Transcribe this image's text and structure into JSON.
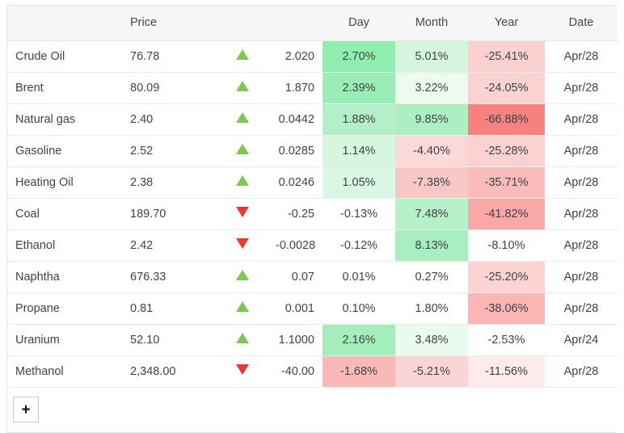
{
  "table": {
    "columns": [
      {
        "key": "name",
        "label": "",
        "align": "left"
      },
      {
        "key": "price",
        "label": "Price",
        "align": "left"
      },
      {
        "key": "arrow",
        "label": "",
        "align": "center"
      },
      {
        "key": "change",
        "label": "",
        "align": "right"
      },
      {
        "key": "day",
        "label": "Day",
        "align": "center"
      },
      {
        "key": "month",
        "label": "Month",
        "align": "center"
      },
      {
        "key": "year",
        "label": "Year",
        "align": "center"
      },
      {
        "key": "date",
        "label": "Date",
        "align": "center"
      }
    ],
    "rows": [
      {
        "name": "Crude Oil",
        "price": "76.78",
        "direction": "up",
        "change": "2.020",
        "day": "2.70%",
        "day_bg": "#90eeaf",
        "month": "5.01%",
        "month_bg": "#d5f5de",
        "year": "-25.41%",
        "year_bg": "#fbd0d0",
        "date": "Apr/28"
      },
      {
        "name": "Brent",
        "price": "80.09",
        "direction": "up",
        "change": "1.870",
        "day": "2.39%",
        "day_bg": "#9aeeb5",
        "month": "3.22%",
        "month_bg": "#ecfaf0",
        "year": "-24.05%",
        "year_bg": "#fbd3d3",
        "date": "Apr/28"
      },
      {
        "name": "Natural gas",
        "price": "2.40",
        "direction": "up",
        "change": "0.0442",
        "day": "1.88%",
        "day_bg": "#b3f0c7",
        "month": "9.85%",
        "month_bg": "#acefc2",
        "year": "-66.88%",
        "year_bg": "#f6817f",
        "date": "Apr/28"
      },
      {
        "name": "Gasoline",
        "price": "2.52",
        "direction": "up",
        "change": "0.0285",
        "day": "1.14%",
        "day_bg": "#d6f6e0",
        "month": "-4.40%",
        "month_bg": "#fbd9d9",
        "year": "-25.28%",
        "year_bg": "#fbd1d1",
        "date": "Apr/28"
      },
      {
        "name": "Heating Oil",
        "price": "2.38",
        "direction": "up",
        "change": "0.0246",
        "day": "1.05%",
        "day_bg": "#d9f7e2",
        "month": "-7.38%",
        "month_bg": "#fac7c7",
        "year": "-35.71%",
        "year_bg": "#f9bcbb",
        "date": "Apr/28"
      },
      {
        "name": "Coal",
        "price": "189.70",
        "direction": "down",
        "change": "-0.25",
        "day": "-0.13%",
        "day_bg": "#ffffff",
        "month": "7.48%",
        "month_bg": "#b6f1c8",
        "year": "-41.82%",
        "year_bg": "#f9a8a6",
        "date": "Apr/28"
      },
      {
        "name": "Ethanol",
        "price": "2.42",
        "direction": "down",
        "change": "-0.0028",
        "day": "-0.12%",
        "day_bg": "#ffffff",
        "month": "8.13%",
        "month_bg": "#a8eec0",
        "year": "-8.10%",
        "year_bg": "#ffffff",
        "date": "Apr/28"
      },
      {
        "name": "Naphtha",
        "price": "676.33",
        "direction": "up",
        "change": "0.07",
        "day": "0.01%",
        "day_bg": "#ffffff",
        "month": "0.27%",
        "month_bg": "#ffffff",
        "year": "-25.20%",
        "year_bg": "#fbd4d3",
        "date": "Apr/28"
      },
      {
        "name": "Propane",
        "price": "0.81",
        "direction": "up",
        "change": "0.001",
        "day": "0.10%",
        "day_bg": "#ffffff",
        "month": "1.80%",
        "month_bg": "#ffffff",
        "year": "-38.06%",
        "year_bg": "#f9b6b5",
        "date": "Apr/28"
      },
      {
        "name": "Uranium",
        "price": "52.10",
        "direction": "up",
        "change": "1.1000",
        "day": "2.16%",
        "day_bg": "#a3eebb",
        "month": "3.48%",
        "month_bg": "#eafaef",
        "year": "-2.53%",
        "year_bg": "#ffffff",
        "date": "Apr/24"
      },
      {
        "name": "Methanol",
        "price": "2,348.00",
        "direction": "down",
        "change": "-40.00",
        "day": "-1.68%",
        "day_bg": "#fab8b7",
        "month": "-5.21%",
        "month_bg": "#fbd5d5",
        "year": "-11.56%",
        "year_bg": "#fdeaea",
        "date": "Apr/28"
      }
    ],
    "add_button_label": "+",
    "add_button_icon": "plus-icon"
  },
  "colors": {
    "header_bg": "#f6f6f6",
    "border": "#e4e4e4",
    "row_border": "#ececec",
    "text": "#3f4448",
    "up_arrow": "#7dc855",
    "down_arrow": "#e8392f"
  }
}
